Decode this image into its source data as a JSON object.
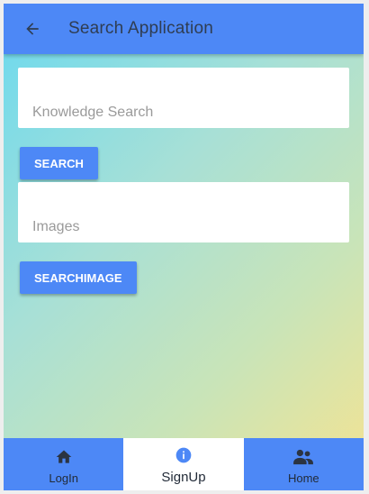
{
  "appbar": {
    "title": "Search Application",
    "back_icon": "arrow-left-icon"
  },
  "search": {
    "knowledge_placeholder": "Knowledge Search",
    "knowledge_value": "",
    "search_label": "Search",
    "images_placeholder": "Images",
    "images_value": "",
    "search_image_label": "SearchImage"
  },
  "nav": {
    "items": [
      {
        "label": "LogIn",
        "icon": "home-icon",
        "active": false
      },
      {
        "label": "SignUp",
        "icon": "info-icon",
        "active": true
      },
      {
        "label": "Home",
        "icon": "people-icon",
        "active": false
      }
    ]
  },
  "colors": {
    "primary": "#4d88f6",
    "nav_text": "#222b38",
    "title_text": "#2f3d52"
  }
}
